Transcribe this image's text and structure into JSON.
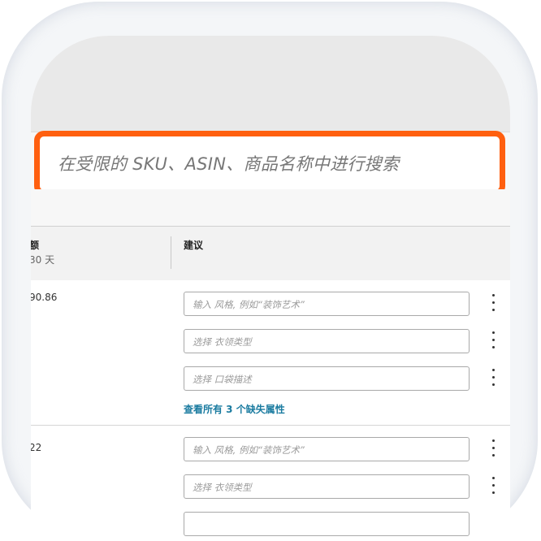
{
  "search": {
    "placeholder": "在受限的 SKU、ASIN、商品名称中进行搜索"
  },
  "table": {
    "headers": {
      "sales": "额",
      "sales_period": "30 天",
      "suggestion": "建议"
    },
    "rows": [
      {
        "sales": "90.86",
        "fields": [
          "输入 风格, 例如“装饰艺术”",
          "选择 衣领类型",
          "选择 口袋描述"
        ],
        "link": "查看所有 3 个缺失属性"
      },
      {
        "sales": "22",
        "fields": [
          "输入 风格, 例如“装饰艺术”",
          "选择 衣领类型"
        ]
      }
    ]
  },
  "colors": {
    "highlight_border": "#ff5f0f",
    "link": "#1a7ba0"
  },
  "icons": {
    "row_menu": "more-vertical-icon"
  }
}
